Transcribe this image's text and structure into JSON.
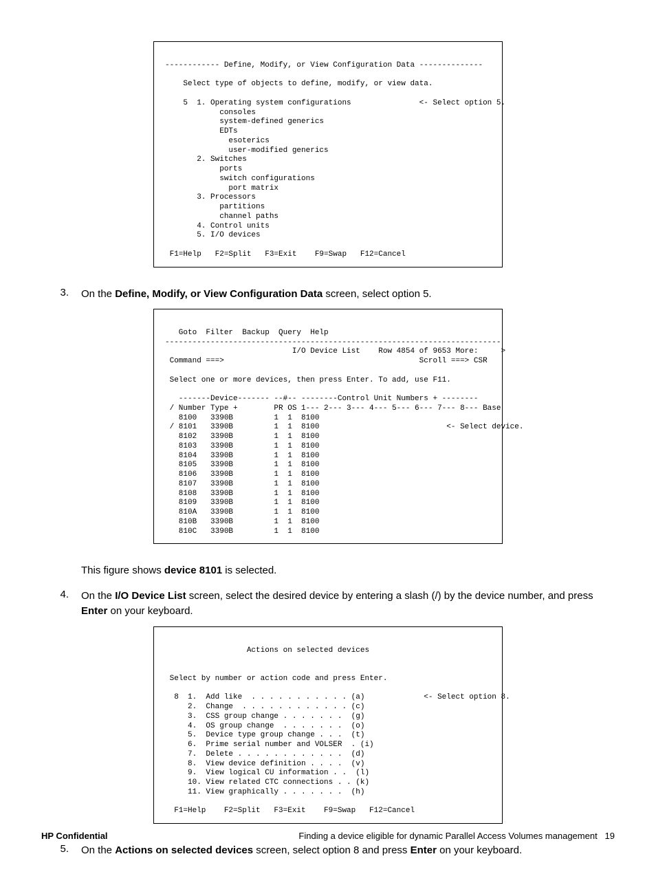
{
  "screen1": {
    "title_line": "------------ Define, Modify, or View Configuration Data --------------",
    "prompt": "    Select type of objects to define, modify, or view data.",
    "lines": [
      "    5  1. Operating system configurations               <- Select option 5.",
      "            consoles",
      "            system-defined generics",
      "            EDTs",
      "              esoterics",
      "              user-modified generics",
      "       2. Switches",
      "            ports",
      "            switch configurations",
      "              port matrix",
      "       3. Processors",
      "            partitions",
      "            channel paths",
      "       4. Control units",
      "       5. I/O devices"
    ],
    "fkeys": " F1=Help   F2=Split   F3=Exit    F9=Swap   F12=Cancel"
  },
  "step3": {
    "num": "3.",
    "text_before": "On the ",
    "bold": "Define, Modify, or View Configuration Data",
    "text_after": " screen, select option 5."
  },
  "screen2": {
    "menu": "   Goto  Filter  Backup  Query  Help",
    "rule": "--------------------------------------------------------------------------",
    "title_row": "                            I/O Device List    Row 4854 of 9653 More:     >",
    "command": " Command ===>                                           Scroll ===> CSR",
    "instr": " Select one or more devices, then press Enter. To add, use F11.",
    "hdr1": "   -------Device------- --#-- --------Control Unit Numbers + --------",
    "hdr2": " / Number Type +        PR OS 1--- 2--- 3--- 4--- 5--- 6--- 7--- 8--- Base",
    "rows": [
      "   8100   3390B         1  1  8100",
      " / 8101   3390B         1  1  8100                            <- Select device.",
      "   8102   3390B         1  1  8100",
      "   8103   3390B         1  1  8100",
      "   8104   3390B         1  1  8100",
      "   8105   3390B         1  1  8100",
      "   8106   3390B         1  1  8100",
      "   8107   3390B         1  1  8100",
      "   8108   3390B         1  1  8100",
      "   8109   3390B         1  1  8100",
      "   810A   3390B         1  1  8100",
      "   810B   3390B         1  1  8100",
      "   810C   3390B         1  1  8100"
    ]
  },
  "caption2": {
    "before": "This figure shows ",
    "bold": "device 8101",
    "after": " is selected."
  },
  "step4": {
    "num": "4.",
    "t1": "On the ",
    "b1": "I/O Device List",
    "t2": " screen, select the desired device by entering a slash (/) by the device number, and press ",
    "b2": "Enter",
    "t3": " on your keyboard."
  },
  "screen3": {
    "title": "                  Actions on selected devices",
    "instr": " Select by number or action code and press Enter.",
    "lines": [
      "  8  1.  Add like  . . . . . . . . . . . (a)             <- Select option 8.",
      "     2.  Change  . . . . . . . . . . . . (c)",
      "     3.  CSS group change . . . . . . .  (g)",
      "     4.  OS group change  . . . . . . .  (o)",
      "     5.  Device type group change . . .  (t)",
      "     6.  Prime serial number and VOLSER  . (i)",
      "     7.  Delete . . . . . . . . . . . .  (d)",
      "     8.  View device definition . . . .  (v)",
      "     9.  View logical CU information . .  (l)",
      "     10. View related CTC connections . . (k)",
      "     11. View graphically . . . . . . .  (h)"
    ],
    "fkeys": "  F1=Help    F2=Split   F3=Exit    F9=Swap   F12=Cancel"
  },
  "step5": {
    "num": "5.",
    "t1": "On the ",
    "b1": "Actions on selected devices",
    "t2": " screen, select option 8 and press ",
    "b2": "Enter",
    "t3": " on your keyboard."
  },
  "footer": {
    "left": "HP Confidential",
    "right_text": "Finding a device eligible for dynamic Parallel Access Volumes management",
    "page": "19"
  }
}
